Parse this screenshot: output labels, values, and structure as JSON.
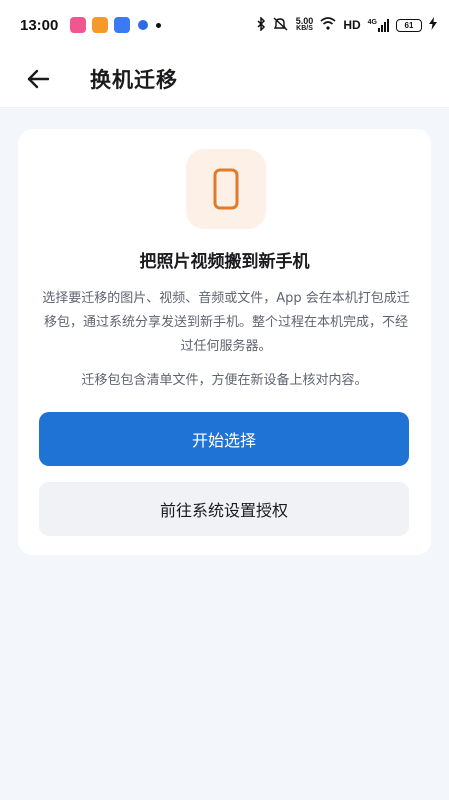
{
  "status_bar": {
    "time": "13:00",
    "net_speed_value": "5.00",
    "net_speed_unit": "KB/S",
    "hd_label": "HD",
    "network_type": "4G",
    "battery_level": "61"
  },
  "header": {
    "title": "换机迁移"
  },
  "card": {
    "icon": "smartphone-icon",
    "accent_color": "#e07a2c",
    "title": "把照片视频搬到新手机",
    "description": "选择要迁移的图片、视频、音频或文件，App 会在本机打包成迁移包，通过系统分享发送到新手机。整个过程在本机完成，不经过任何服务器。",
    "note": "迁移包包含清单文件，方便在新设备上核对内容。",
    "primary_button": "开始选择",
    "secondary_button": "前往系统设置授权"
  },
  "colors": {
    "primary": "#1f73d4",
    "background": "#f3f6fb"
  }
}
